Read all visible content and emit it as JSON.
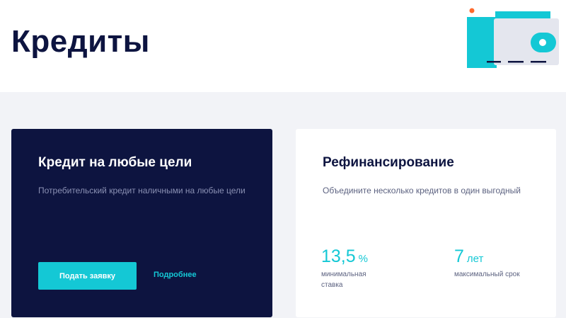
{
  "page": {
    "title": "Кредиты"
  },
  "colors": {
    "navy": "#0d1440",
    "accent": "#14c8d5",
    "background": "#f2f3f7",
    "orange_dot": "#ff6a2c",
    "light_gray": "#e4e6ee"
  },
  "illustration": {
    "icon": "wallet-illustration-icon"
  },
  "cards": [
    {
      "title": "Кредит на любые цели",
      "description": "Потребительский кредит наличными на любые цели",
      "button_label": "Подать заявку",
      "link_label": "Подробнее"
    },
    {
      "title": "Рефинансирование",
      "description": "Объедините несколько кредитов в один выгодный",
      "stats": [
        {
          "value": "13,5",
          "unit": "%",
          "label": "минимальная ставка"
        },
        {
          "value": "7",
          "unit": "лет",
          "label": "максимальный срок"
        }
      ]
    }
  ]
}
